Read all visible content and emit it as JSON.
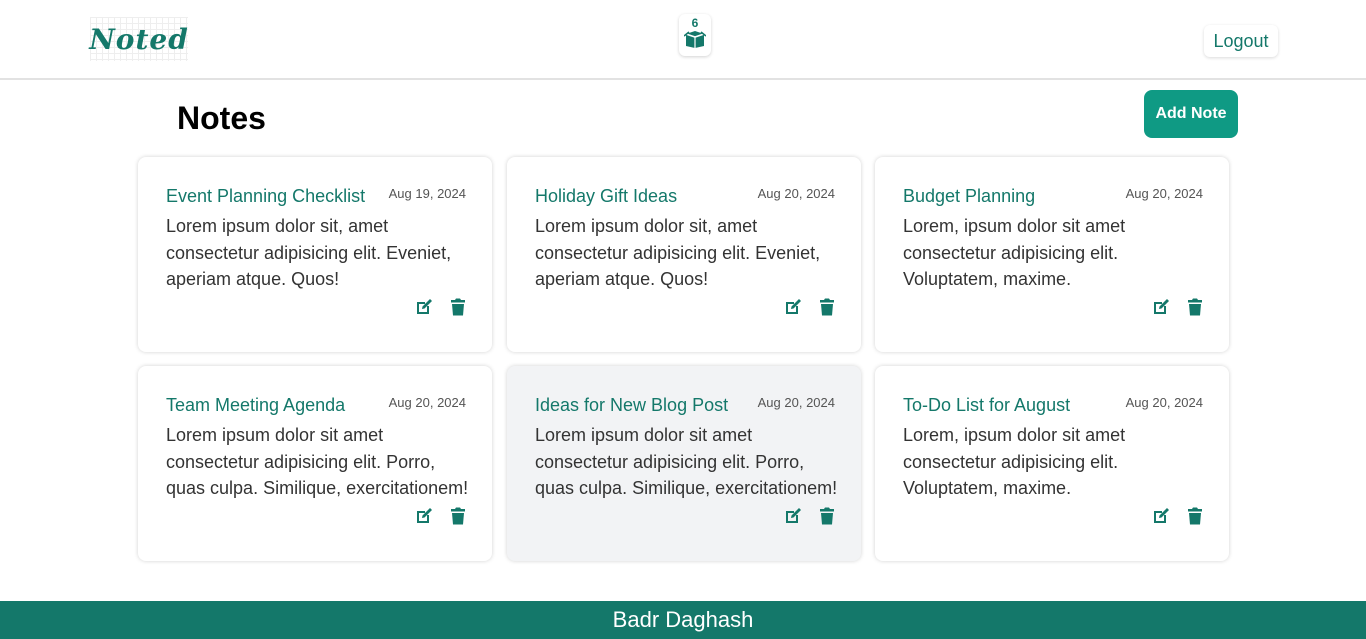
{
  "header": {
    "logo_text": "Noted",
    "box_count": "6",
    "logout_label": "Logout"
  },
  "main": {
    "title": "Notes",
    "add_label": "Add Note"
  },
  "notes": [
    {
      "title": "Event Planning Checklist",
      "date": "Aug 19, 2024",
      "body": "Lorem ipsum dolor sit, amet consectetur adipisicing elit. Eveniet, aperiam atque. Quos!"
    },
    {
      "title": "Holiday Gift Ideas",
      "date": "Aug 20, 2024",
      "body": "Lorem ipsum dolor sit, amet consectetur adipisicing elit. Eveniet, aperiam atque. Quos!"
    },
    {
      "title": "Budget Planning",
      "date": "Aug 20, 2024",
      "body": "Lorem, ipsum dolor sit amet consectetur adipisicing elit. Voluptatem, maxime."
    },
    {
      "title": "Team Meeting Agenda",
      "date": "Aug 20, 2024",
      "body": "Lorem ipsum dolor sit amet consectetur adipisicing elit. Porro, quas culpa. Similique, exercitationem!"
    },
    {
      "title": "Ideas for New Blog Post",
      "date": "Aug 20, 2024",
      "body": "Lorem ipsum dolor sit amet consectetur adipisicing elit. Porro, quas culpa. Similique, exercitationem!"
    },
    {
      "title": "To-Do List for August",
      "date": "Aug 20, 2024",
      "body": "Lorem, ipsum dolor sit amet consectetur adipisicing elit. Voluptatem, maxime."
    }
  ],
  "footer": {
    "text": "Badr Daghash"
  },
  "colors": {
    "brand": "#14786a",
    "accent_button": "#0f9a84",
    "hover_card": "#f2f3f5"
  },
  "icons": [
    "box-icon",
    "edit-icon",
    "trash-icon"
  ]
}
